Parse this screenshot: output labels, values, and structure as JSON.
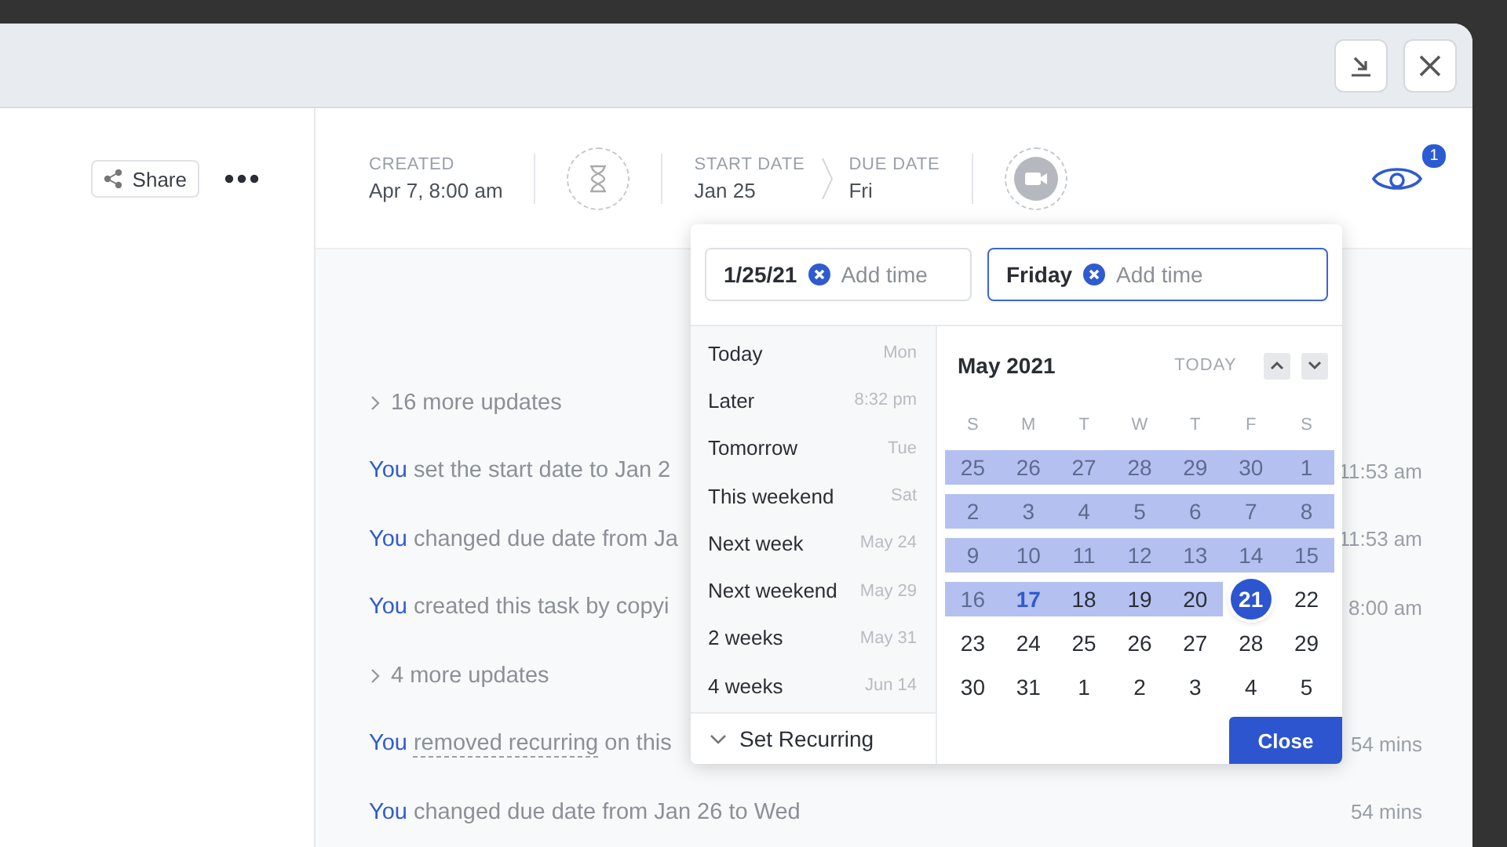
{
  "toolbar": {
    "share": "Share",
    "created": {
      "label": "CREATED",
      "value": "Apr 7, 8:00 am"
    },
    "start_date": {
      "label": "START DATE",
      "value": "Jan 25"
    },
    "due_date": {
      "label": "DUE DATE",
      "value": "Fri"
    },
    "watcher_count": "1"
  },
  "activity": [
    {
      "kind": "more",
      "text": "16 more updates"
    },
    {
      "kind": "event",
      "actor": "You",
      "text": "set the start date to Jan 2",
      "time": "11:53 am"
    },
    {
      "kind": "event",
      "actor": "You",
      "text": "changed due date from Ja",
      "time": "11:53 am"
    },
    {
      "kind": "event",
      "actor": "You",
      "text": "created this task by copyi",
      "time": "8:00 am"
    },
    {
      "kind": "more",
      "text": "4 more updates"
    },
    {
      "kind": "event",
      "actor": "You",
      "link": "removed recurring",
      "text": "on this",
      "time": "54 mins"
    },
    {
      "kind": "event",
      "actor": "You",
      "text": "changed due date from Jan 26 to Wed",
      "time": "54 mins"
    }
  ],
  "date_picker": {
    "start_field": {
      "value": "1/25/21",
      "placeholder": "Add time",
      "focused": false
    },
    "due_field": {
      "value": "Friday",
      "placeholder": "Add time",
      "focused": true
    },
    "shortcuts": [
      {
        "label": "Today",
        "hint": "Mon"
      },
      {
        "label": "Later",
        "hint": "8:32 pm"
      },
      {
        "label": "Tomorrow",
        "hint": "Tue"
      },
      {
        "label": "This weekend",
        "hint": "Sat"
      },
      {
        "label": "Next week",
        "hint": "May 24"
      },
      {
        "label": "Next weekend",
        "hint": "May 29"
      },
      {
        "label": "2 weeks",
        "hint": "May 31"
      },
      {
        "label": "4 weeks",
        "hint": "Jun 14"
      }
    ],
    "recurring": "Set Recurring",
    "month": "May 2021",
    "today_button": "TODAY",
    "weekdays": [
      "S",
      "M",
      "T",
      "W",
      "T",
      "F",
      "S"
    ],
    "weeks": [
      [
        {
          "d": "25",
          "in_range": true,
          "muted": true,
          "today": false,
          "selected": false
        },
        {
          "d": "26",
          "in_range": true,
          "muted": true,
          "today": false,
          "selected": false
        },
        {
          "d": "27",
          "in_range": true,
          "muted": true,
          "today": false,
          "selected": false
        },
        {
          "d": "28",
          "in_range": true,
          "muted": true,
          "today": false,
          "selected": false
        },
        {
          "d": "29",
          "in_range": true,
          "muted": true,
          "today": false,
          "selected": false
        },
        {
          "d": "30",
          "in_range": true,
          "muted": true,
          "today": false,
          "selected": false
        },
        {
          "d": "1",
          "in_range": true,
          "muted": true,
          "today": false,
          "selected": false
        }
      ],
      [
        {
          "d": "2",
          "in_range": true,
          "muted": true,
          "today": false,
          "selected": false
        },
        {
          "d": "3",
          "in_range": true,
          "muted": true,
          "today": false,
          "selected": false
        },
        {
          "d": "4",
          "in_range": true,
          "muted": true,
          "today": false,
          "selected": false
        },
        {
          "d": "5",
          "in_range": true,
          "muted": true,
          "today": false,
          "selected": false
        },
        {
          "d": "6",
          "in_range": true,
          "muted": true,
          "today": false,
          "selected": false
        },
        {
          "d": "7",
          "in_range": true,
          "muted": true,
          "today": false,
          "selected": false
        },
        {
          "d": "8",
          "in_range": true,
          "muted": true,
          "today": false,
          "selected": false
        }
      ],
      [
        {
          "d": "9",
          "in_range": true,
          "muted": true,
          "today": false,
          "selected": false
        },
        {
          "d": "10",
          "in_range": true,
          "muted": true,
          "today": false,
          "selected": false
        },
        {
          "d": "11",
          "in_range": true,
          "muted": true,
          "today": false,
          "selected": false
        },
        {
          "d": "12",
          "in_range": true,
          "muted": true,
          "today": false,
          "selected": false
        },
        {
          "d": "13",
          "in_range": true,
          "muted": true,
          "today": false,
          "selected": false
        },
        {
          "d": "14",
          "in_range": true,
          "muted": true,
          "today": false,
          "selected": false
        },
        {
          "d": "15",
          "in_range": true,
          "muted": true,
          "today": false,
          "selected": false
        }
      ],
      [
        {
          "d": "16",
          "in_range": true,
          "muted": true,
          "today": false,
          "selected": false
        },
        {
          "d": "17",
          "in_range": true,
          "muted": false,
          "today": true,
          "selected": false
        },
        {
          "d": "18",
          "in_range": true,
          "muted": false,
          "today": false,
          "selected": false
        },
        {
          "d": "19",
          "in_range": true,
          "muted": false,
          "today": false,
          "selected": false
        },
        {
          "d": "20",
          "in_range": true,
          "muted": false,
          "today": false,
          "selected": false
        },
        {
          "d": "21",
          "in_range": false,
          "muted": false,
          "today": false,
          "selected": true
        },
        {
          "d": "22",
          "in_range": false,
          "muted": false,
          "today": false,
          "selected": false
        }
      ],
      [
        {
          "d": "23",
          "in_range": false,
          "muted": false,
          "today": false,
          "selected": false
        },
        {
          "d": "24",
          "in_range": false,
          "muted": false,
          "today": false,
          "selected": false
        },
        {
          "d": "25",
          "in_range": false,
          "muted": false,
          "today": false,
          "selected": false
        },
        {
          "d": "26",
          "in_range": false,
          "muted": false,
          "today": false,
          "selected": false
        },
        {
          "d": "27",
          "in_range": false,
          "muted": false,
          "today": false,
          "selected": false
        },
        {
          "d": "28",
          "in_range": false,
          "muted": false,
          "today": false,
          "selected": false
        },
        {
          "d": "29",
          "in_range": false,
          "muted": false,
          "today": false,
          "selected": false
        }
      ],
      [
        {
          "d": "30",
          "in_range": false,
          "muted": false,
          "today": false,
          "selected": false
        },
        {
          "d": "31",
          "in_range": false,
          "muted": false,
          "today": false,
          "selected": false
        },
        {
          "d": "1",
          "in_range": false,
          "muted": false,
          "today": false,
          "selected": false
        },
        {
          "d": "2",
          "in_range": false,
          "muted": false,
          "today": false,
          "selected": false
        },
        {
          "d": "3",
          "in_range": false,
          "muted": false,
          "today": false,
          "selected": false
        },
        {
          "d": "4",
          "in_range": false,
          "muted": false,
          "today": false,
          "selected": false
        },
        {
          "d": "5",
          "in_range": false,
          "muted": false,
          "today": false,
          "selected": false
        }
      ]
    ],
    "close": "Close"
  }
}
